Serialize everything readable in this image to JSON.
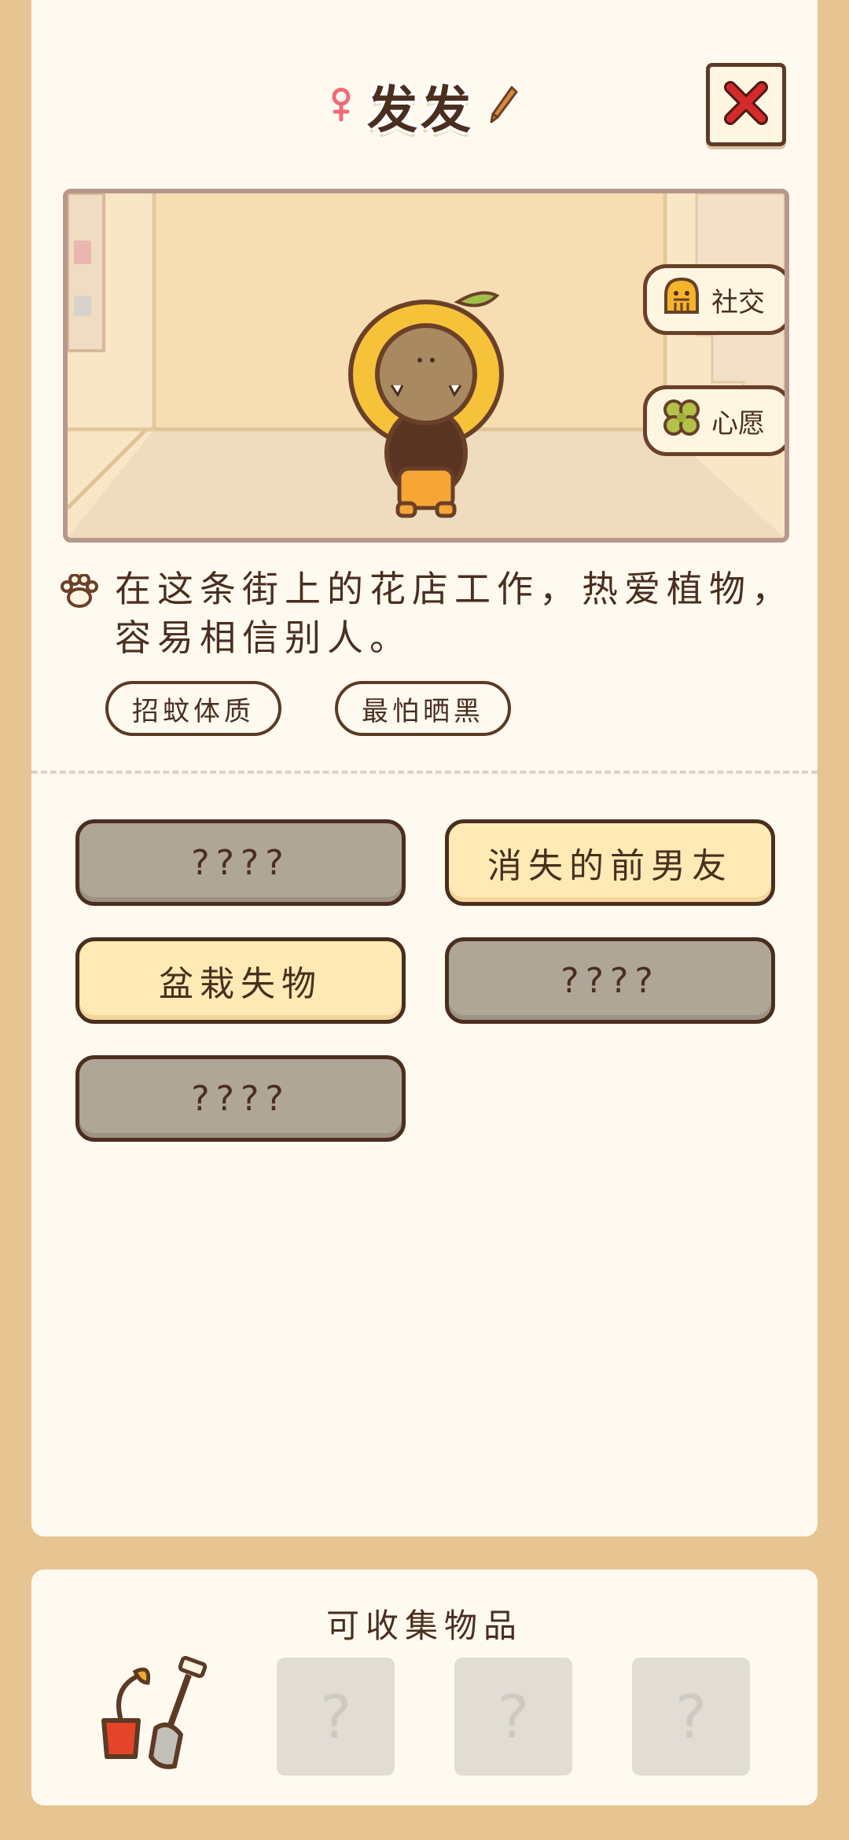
{
  "header": {
    "name": "发发",
    "gender_icon": "female-icon",
    "edit_icon": "pencil-icon",
    "close_icon": "close-x-icon"
  },
  "scene": {
    "side_buttons": [
      {
        "label": "社交",
        "icon": "ghost-icon"
      },
      {
        "label": "心愿",
        "icon": "clover-icon"
      }
    ]
  },
  "description": {
    "icon": "paw-icon",
    "text": "在这条街上的花店工作，热爱植物，容易相信别人。"
  },
  "tags": [
    "招蚊体质",
    "最怕晒黑"
  ],
  "stories": [
    {
      "label": "????",
      "state": "locked"
    },
    {
      "label": "消失的前男友",
      "state": "open"
    },
    {
      "label": "盆栽失物",
      "state": "open"
    },
    {
      "label": "????",
      "state": "locked"
    },
    {
      "label": "????",
      "state": "locked"
    }
  ],
  "collectibles": {
    "title": "可收集物品",
    "items": [
      {
        "label": "",
        "icon": "flowerpot-shovel-icon"
      },
      {
        "label": "?"
      },
      {
        "label": "?"
      },
      {
        "label": "?"
      }
    ]
  },
  "colors": {
    "background": "#e6c592",
    "card": "#fffaf0",
    "outline": "#4a2e1f",
    "locked": "#b0a698",
    "open": "#ffeab5",
    "close_x": "#d42a2a"
  }
}
